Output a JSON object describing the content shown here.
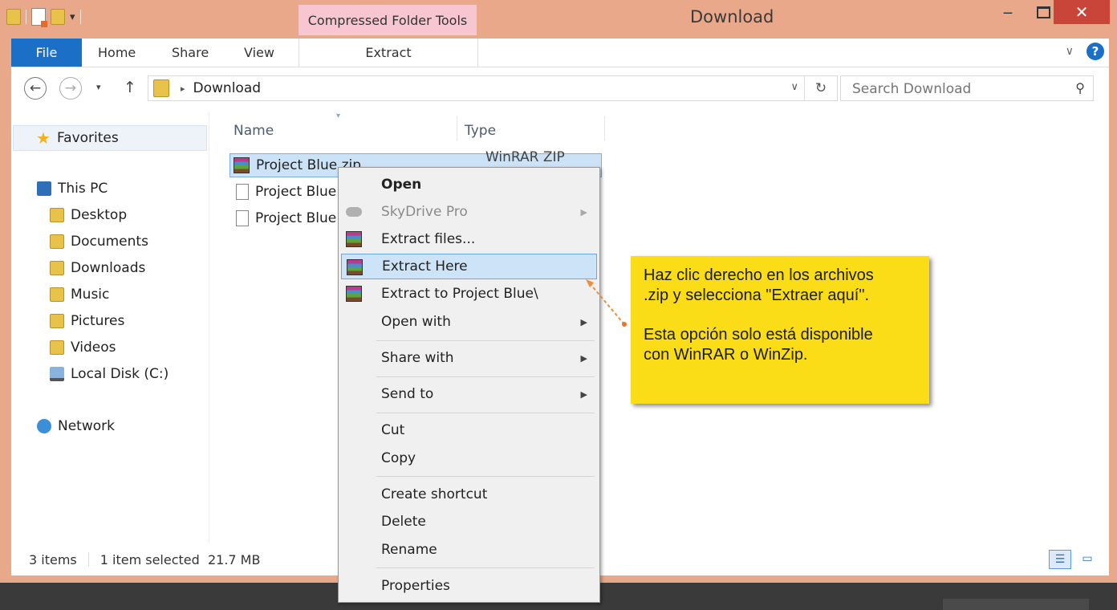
{
  "window": {
    "title": "Download",
    "contextual_tab_group": "Compressed Folder Tools",
    "close_glyph": "✕",
    "minimize_glyph": "‒"
  },
  "ribbon": {
    "tabs": [
      "File",
      "Home",
      "Share",
      "View",
      "Extract"
    ],
    "expand_glyph": "∨",
    "help_glyph": "?"
  },
  "address_bar": {
    "back_glyph": "←",
    "forward_glyph": "→",
    "recent_glyph": "▾",
    "up_glyph": "↑",
    "path": "Download",
    "path_chevron": "▸",
    "dropdown_glyph": "∨",
    "refresh_glyph": "↻"
  },
  "search": {
    "placeholder": "Search Download",
    "icon_glyph": "⚲"
  },
  "nav_pane": {
    "favorites": "Favorites",
    "this_pc": "This PC",
    "pc_items": [
      "Desktop",
      "Documents",
      "Downloads",
      "Music",
      "Pictures",
      "Videos",
      "Local Disk (C:)"
    ],
    "network": "Network"
  },
  "file_list": {
    "columns": [
      "Name",
      "Type"
    ],
    "rows": [
      {
        "name": "Project Blue.zip",
        "type": "WinRAR ZIP archive",
        "selected": true,
        "icon": "winrar-icon"
      },
      {
        "name": "Project Blue",
        "type": "",
        "selected": false,
        "icon": "file-icon"
      },
      {
        "name": "Project Blue",
        "type": "",
        "selected": false,
        "icon": "file-icon"
      }
    ]
  },
  "status_bar": {
    "item_count": "3 items",
    "selection": "1 item selected  21.7 MB"
  },
  "context_menu": {
    "items": [
      {
        "label": "Open",
        "bold": true
      },
      {
        "label": "SkyDrive Pro",
        "disabled": true,
        "submenu": true,
        "icon": "cloud-icon"
      },
      {
        "label": "Extract files...",
        "icon": "winrar-icon"
      },
      {
        "label": "Extract Here",
        "highlighted": true,
        "icon": "winrar-icon"
      },
      {
        "label": "Extract to Project Blue\\",
        "icon": "winrar-icon"
      },
      {
        "label": "Open with",
        "submenu": true
      },
      {
        "label": "Share with",
        "submenu": true
      },
      {
        "label": "Send to",
        "submenu": true
      },
      {
        "label": "Cut"
      },
      {
        "label": "Copy"
      },
      {
        "label": "Create shortcut"
      },
      {
        "label": "Delete"
      },
      {
        "label": "Rename"
      },
      {
        "label": "Properties"
      }
    ],
    "submenu_glyph": "▶"
  },
  "callout": {
    "line1": "Haz clic derecho en los archivos\n.zip y selecciona \"Extraer aquí\".",
    "line2": "Esta opción solo está disponible\ncon WinRAR o WinZip.",
    "color": "#fadd16"
  },
  "colors": {
    "frame": "#e8a98a",
    "file_tab": "#1c6fc7",
    "context_tab_group": "#f7c6d0",
    "close_button": "#c9453a",
    "highlight": "#cde3f8"
  }
}
